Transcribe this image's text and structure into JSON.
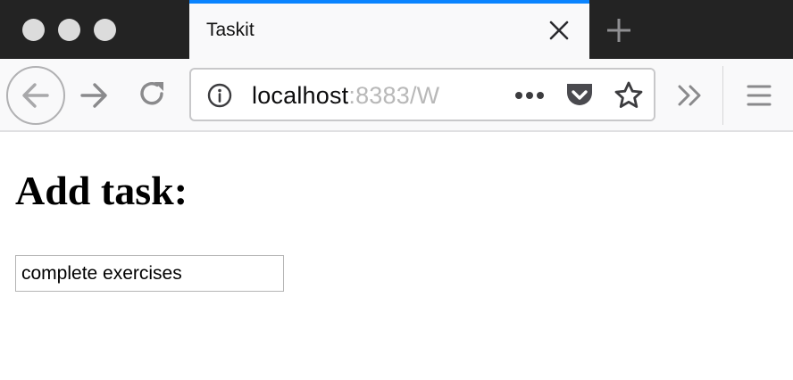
{
  "window": {
    "tab_title": "Taskit",
    "accent_color": "#0a84ff",
    "icons": [
      "window-close-dot-icon",
      "window-minimize-dot-icon",
      "window-maximize-dot-icon",
      "close-icon",
      "plus-icon",
      "back-arrow-icon",
      "forward-arrow-icon",
      "reload-icon",
      "info-icon",
      "more-dots-icon",
      "pocket-icon",
      "star-icon",
      "chevron-double-right-icon",
      "hamburger-menu-icon"
    ]
  },
  "url": {
    "host": "localhost",
    "rest": ":8383/W"
  },
  "page": {
    "heading": "Add task:",
    "task_input_value": "complete exercises"
  }
}
